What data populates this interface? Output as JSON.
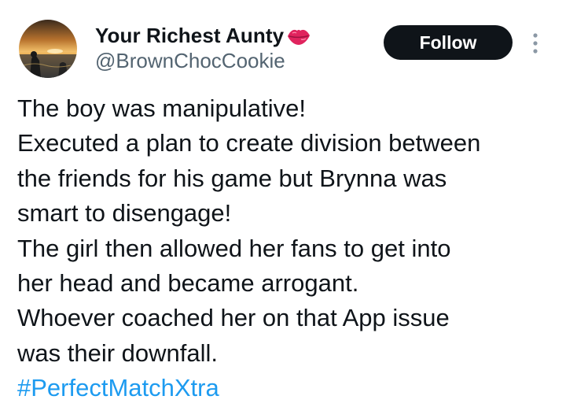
{
  "author": {
    "display_name": "Your Richest Aunty",
    "handle": "@BrownChocCookie",
    "name_emoji": "kiss-mark-lips-icon"
  },
  "actions": {
    "follow_label": "Follow",
    "more_icon": "more-vertical-icon"
  },
  "tweet": {
    "lines": [
      "The boy was manipulative!",
      "Executed a plan to create division between",
      "the friends for his game but Brynna was",
      "smart to disengage!",
      "The girl then allowed her fans to get into",
      "her head and became arrogant.",
      "Whoever coached her on that App issue",
      "was their downfall."
    ],
    "hashtag": "#PerfectMatchXtra"
  },
  "colors": {
    "text": "#0f1419",
    "secondary": "#536471",
    "link": "#1d9bf0",
    "button_bg": "#0f1419",
    "button_text": "#ffffff",
    "lips": "#e0245e"
  }
}
